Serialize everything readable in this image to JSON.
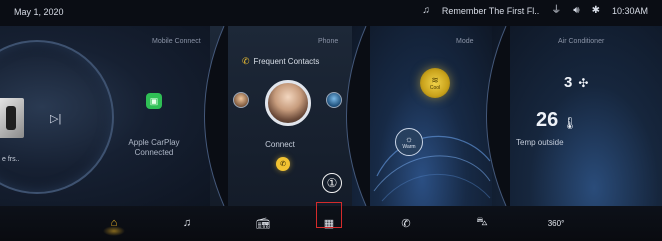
{
  "status_bar": {
    "date": "May 1, 2020",
    "now_playing": "Remember The First Fl..",
    "time": "10:30AM",
    "icons": [
      "music-note-icon",
      "usb-icon",
      "volume-icon",
      "bluetooth-icon"
    ]
  },
  "panels": {
    "mobile_connect": {
      "title": "Mobile Connect",
      "song_fragment": "e frs..",
      "carplay_status": "Apple CarPlay Connected",
      "icons": [
        "album-art",
        "skip-next-icon",
        "carplay-icon"
      ]
    },
    "phone": {
      "title": "Phone",
      "frequent_contacts": "Frequent Contacts",
      "connect_label": "Connect",
      "icons": [
        "phone-icon",
        "contact-avatar"
      ]
    },
    "mode": {
      "title": "Mode",
      "cool_label": "Cool",
      "warm_label": "Warm",
      "icons": [
        "wave-icon",
        "sun-icon"
      ]
    },
    "air_conditioner": {
      "title": "Air Conditioner",
      "fan_level": "3",
      "temperature": "26",
      "temp_label": "Temp outside",
      "icons": [
        "fan-icon",
        "thermometer-icon"
      ]
    }
  },
  "bottom_nav": {
    "items": [
      {
        "name": "home",
        "icon": "home-icon",
        "active": true
      },
      {
        "name": "music",
        "icon": "music-note-icon"
      },
      {
        "name": "radio",
        "icon": "radio-icon"
      },
      {
        "name": "apps",
        "icon": "apps-grid-icon"
      },
      {
        "name": "phone",
        "icon": "phone-icon"
      },
      {
        "name": "car",
        "icon": "car-icon"
      },
      {
        "name": "360-view",
        "icon": "360-view-icon"
      }
    ],
    "annotation_number": "①",
    "accent": "#f0b727",
    "highlight_color": "#d42b2b"
  }
}
